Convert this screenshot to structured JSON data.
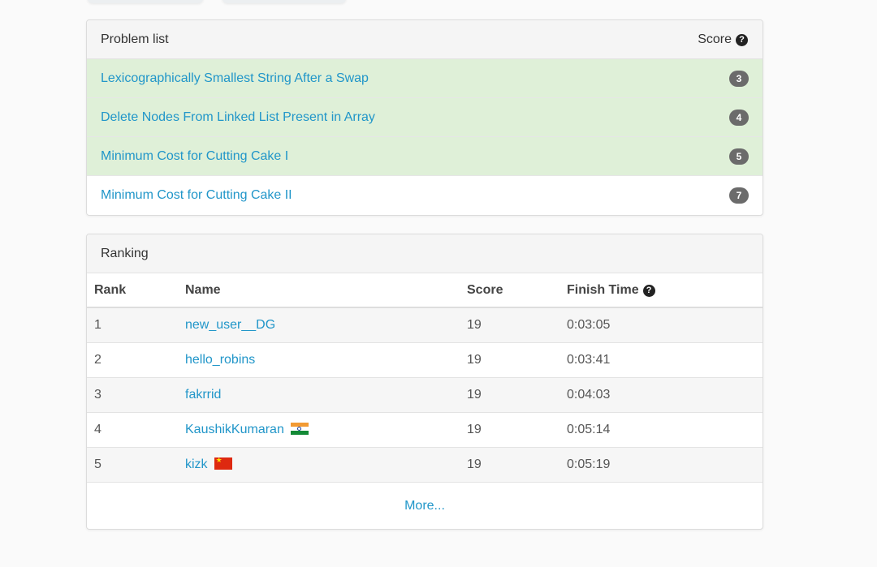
{
  "problems": {
    "title": "Problem list",
    "score_header": "Score",
    "items": [
      {
        "name": "Lexicographically Smallest String After a Swap",
        "score": "3",
        "solved": true
      },
      {
        "name": "Delete Nodes From Linked List Present in Array",
        "score": "4",
        "solved": true
      },
      {
        "name": "Minimum Cost for Cutting Cake I",
        "score": "5",
        "solved": true
      },
      {
        "name": "Minimum Cost for Cutting Cake II",
        "score": "7",
        "solved": false
      }
    ]
  },
  "ranking": {
    "title": "Ranking",
    "columns": {
      "rank": "Rank",
      "name": "Name",
      "score": "Score",
      "finish_time": "Finish Time"
    },
    "rows": [
      {
        "rank": "1",
        "name": "new_user__DG",
        "score": "19",
        "time": "0:03:05",
        "flag": ""
      },
      {
        "rank": "2",
        "name": "hello_robins",
        "score": "19",
        "time": "0:03:41",
        "flag": ""
      },
      {
        "rank": "3",
        "name": "fakrrid",
        "score": "19",
        "time": "0:04:03",
        "flag": ""
      },
      {
        "rank": "4",
        "name": "KaushikKumaran",
        "score": "19",
        "time": "0:05:14",
        "flag": "india-flag-icon"
      },
      {
        "rank": "5",
        "name": "kizk",
        "score": "19",
        "time": "0:05:19",
        "flag": "china-flag-icon"
      }
    ],
    "more": "More..."
  },
  "colors": {
    "link": "#2196c9",
    "solved_bg": "#dff0d8",
    "badge": "#6b6b6b"
  }
}
